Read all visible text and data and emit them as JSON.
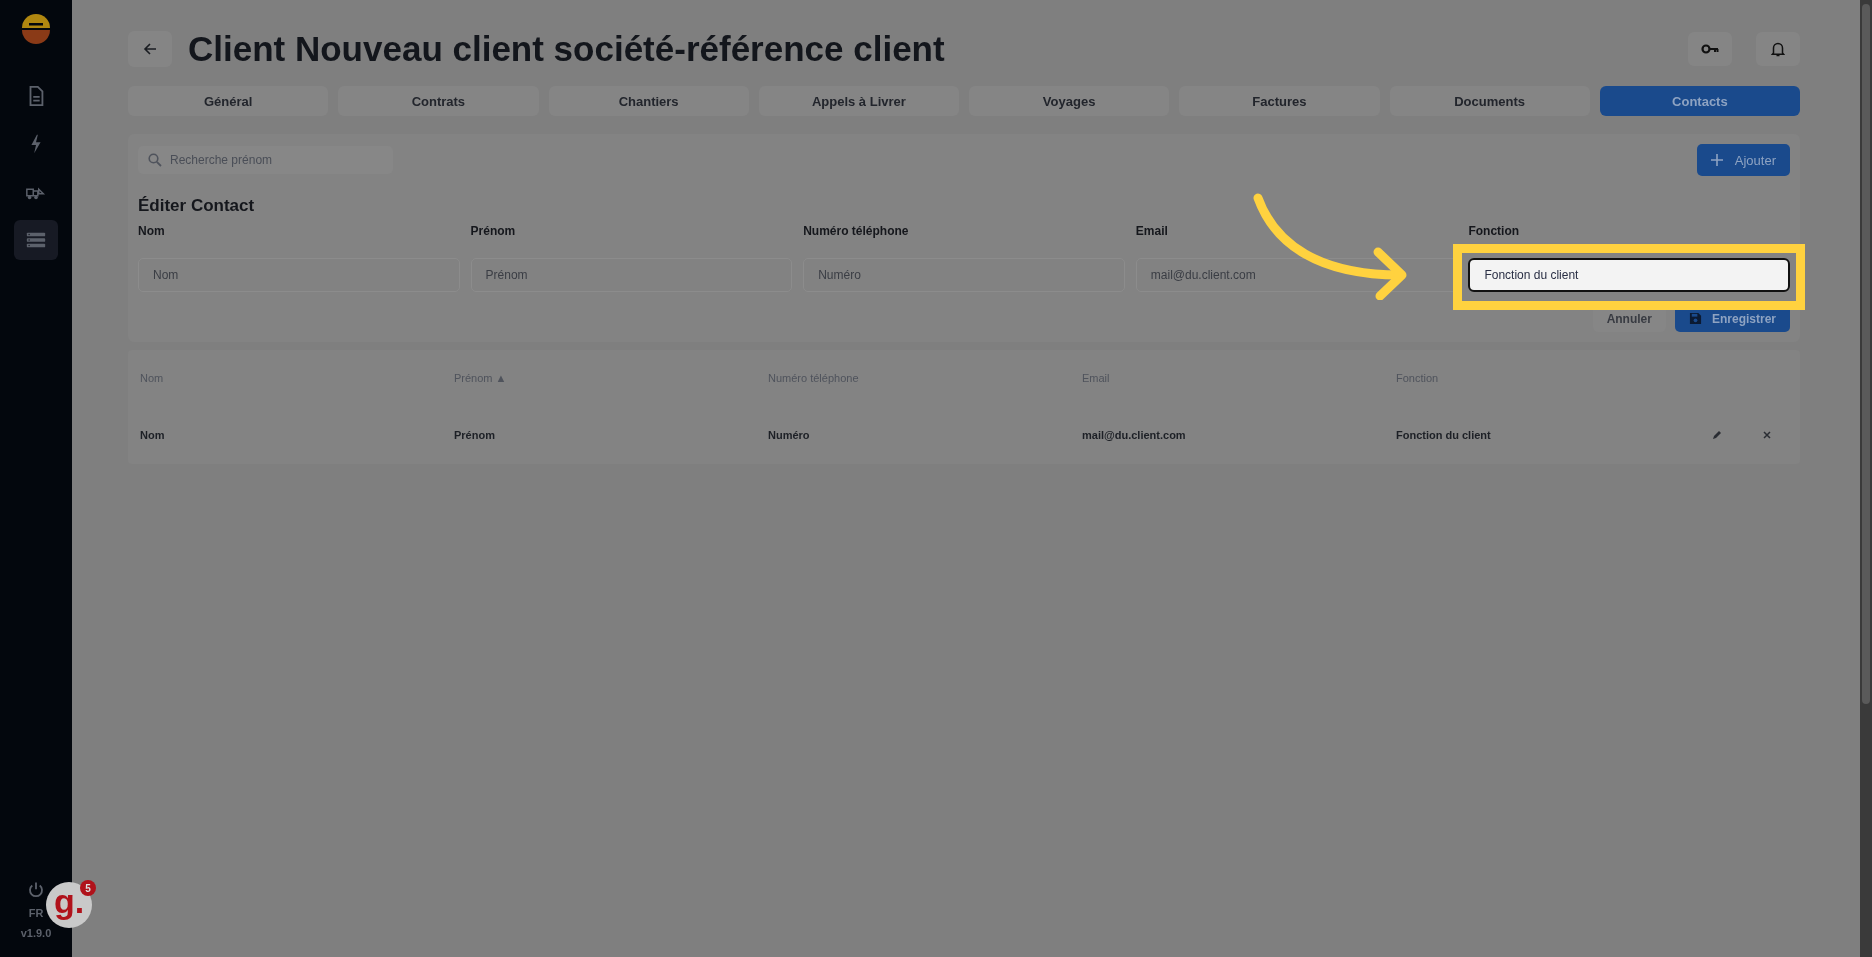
{
  "sidebar": {
    "items": [
      {
        "kind": "document",
        "selected": false
      },
      {
        "kind": "bolt",
        "selected": false
      },
      {
        "kind": "truck",
        "selected": false
      },
      {
        "kind": "list",
        "selected": true
      }
    ],
    "language": "FR",
    "version": "v1.9.0"
  },
  "header": {
    "title": "Client Nouveau client société-référence client"
  },
  "tabs": [
    {
      "label": "Général",
      "selected": false
    },
    {
      "label": "Contrats",
      "selected": false
    },
    {
      "label": "Chantiers",
      "selected": false
    },
    {
      "label": "Appels à Livrer",
      "selected": false
    },
    {
      "label": "Voyages",
      "selected": false
    },
    {
      "label": "Factures",
      "selected": false
    },
    {
      "label": "Documents",
      "selected": false
    },
    {
      "label": "Contacts",
      "selected": true
    }
  ],
  "search": {
    "placeholder": "Recherche prénom"
  },
  "add_button": "Ajouter",
  "form": {
    "title": "Éditer Contact",
    "fields": [
      {
        "label": "Nom",
        "placeholder": "Nom",
        "highlighted": false
      },
      {
        "label": "Prénom",
        "placeholder": "Prénom",
        "highlighted": false
      },
      {
        "label": "Numéro téléphone",
        "placeholder": "Numéro",
        "highlighted": false
      },
      {
        "label": "Email",
        "placeholder": "mail@du.client.com",
        "highlighted": false
      },
      {
        "label": "Fonction",
        "value": "Fonction du client",
        "highlighted": true
      }
    ],
    "cancel": "Annuler",
    "save": "Enregistrer"
  },
  "table": {
    "columns": [
      {
        "label": "Nom",
        "sorted": false
      },
      {
        "label": "Prénom",
        "sorted": true
      },
      {
        "label": "Numéro téléphone",
        "sorted": false
      },
      {
        "label": "Email",
        "sorted": false
      },
      {
        "label": "Fonction",
        "sorted": false
      }
    ],
    "rows": [
      [
        "Nom",
        "Prénom",
        "Numéro",
        "mail@du.client.com",
        "Fonction du client"
      ]
    ],
    "sort_mark": "▲"
  },
  "widget": {
    "label": "g.",
    "count": "5"
  }
}
